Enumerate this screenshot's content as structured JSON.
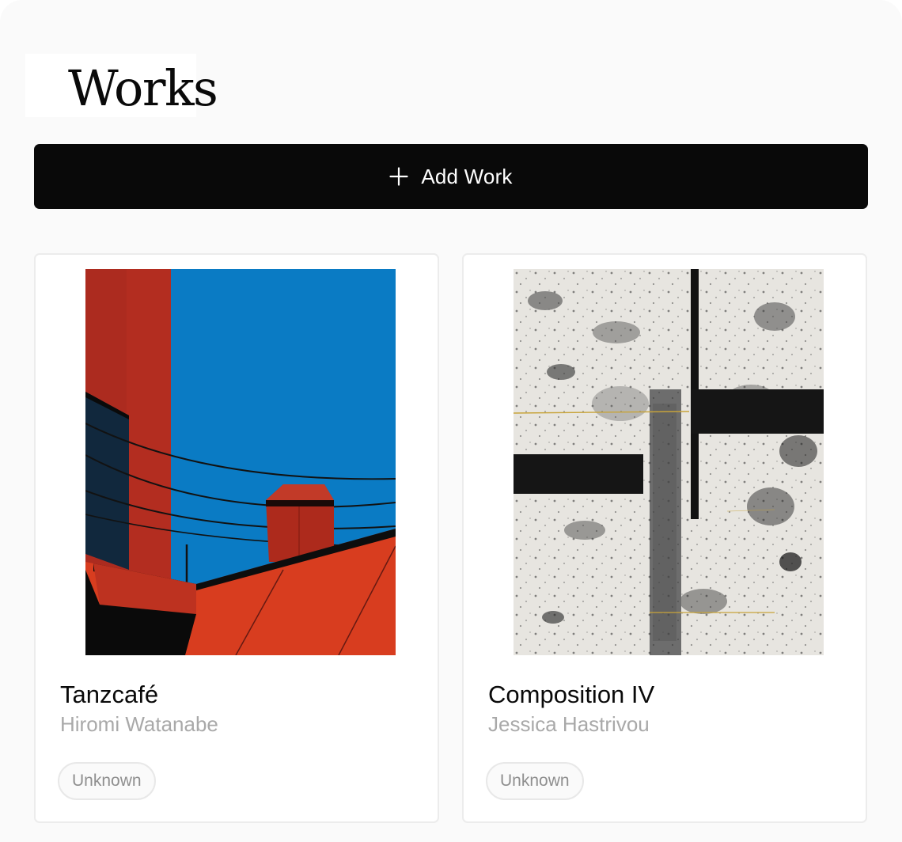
{
  "page": {
    "title": "Works"
  },
  "toolbar": {
    "add_label": "Add Work",
    "add_icon": "plus-icon"
  },
  "works": [
    {
      "title": "Tanzcafé",
      "artist": "Hiromi Watanabe",
      "status": "Unknown",
      "image": "red rooftop and chimney against blue sky with power lines"
    },
    {
      "title": "Composition IV",
      "artist": "Jessica Hastrivou",
      "status": "Unknown",
      "image": "weathered white abstract painting with black crossing bars"
    }
  ],
  "colors": {
    "background": "#fafafa",
    "button": "#090909",
    "card_border": "#ececec",
    "artist_text": "#a9a9a9",
    "badge_text": "#8f8f8f"
  }
}
